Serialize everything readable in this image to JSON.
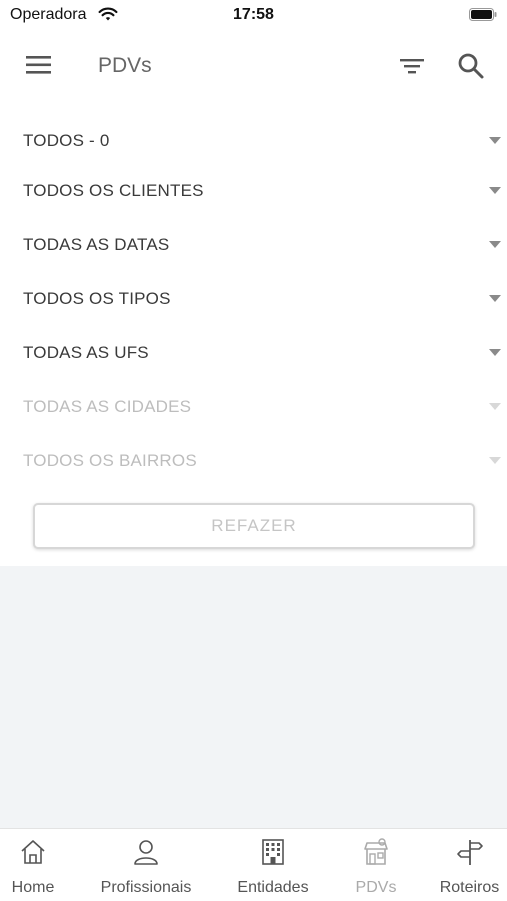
{
  "status_bar": {
    "carrier": "Operadora",
    "time": "17:58"
  },
  "header": {
    "title": "PDVs"
  },
  "filters": [
    {
      "label": "TODOS - 0",
      "enabled": true
    },
    {
      "label": "TODOS OS CLIENTES",
      "enabled": true
    },
    {
      "label": "TODAS AS DATAS",
      "enabled": true
    },
    {
      "label": "TODOS OS TIPOS",
      "enabled": true
    },
    {
      "label": "TODAS AS UFS",
      "enabled": true
    },
    {
      "label": "TODAS AS CIDADES",
      "enabled": false
    },
    {
      "label": "TODOS OS BAIRROS",
      "enabled": false
    }
  ],
  "redo_button": {
    "label": "REFAZER"
  },
  "tabs": [
    {
      "label": "Home",
      "icon": "home-icon"
    },
    {
      "label": "Profissionais",
      "icon": "person-icon"
    },
    {
      "label": "Entidades",
      "icon": "building-icon"
    },
    {
      "label": "PDVs",
      "icon": "store-icon",
      "active": true
    },
    {
      "label": "Roteiros",
      "icon": "signpost-icon"
    }
  ]
}
